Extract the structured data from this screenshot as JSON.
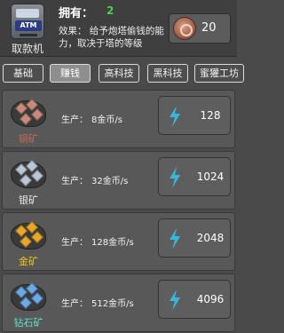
{
  "header": {
    "atm_logo_text": "ATM",
    "atm_name": "取款机",
    "owned_label": "拥有：",
    "owned_value": "2",
    "effect_text": "效果：  给予炮塔偷钱的能力，取决于塔的等级",
    "cost_value": "20",
    "cost_icon": "copper-coin-icon"
  },
  "tabs": [
    {
      "label": "基础",
      "active": false
    },
    {
      "label": "赚钱",
      "active": true
    },
    {
      "label": "高科技",
      "active": false
    },
    {
      "label": "黑科技",
      "active": false
    },
    {
      "label": "蜜獾工坊",
      "active": false
    }
  ],
  "items": [
    {
      "name": "铜矿",
      "name_color": "#c66a55",
      "prod_label": "生产：",
      "prod_value": "8金币/s",
      "price": "128",
      "gem_color": "#c88a7a",
      "icon": "copper-ore-icon"
    },
    {
      "name": "银矿",
      "name_color": "#e8e8e8",
      "prod_label": "生产：",
      "prod_value": "32金币/s",
      "price": "1024",
      "gem_color": "#b9c7d6",
      "icon": "silver-ore-icon"
    },
    {
      "name": "金矿",
      "name_color": "#f0c419",
      "prod_label": "生产：",
      "prod_value": "128金币/s",
      "price": "2048",
      "gem_color": "#e7a82a",
      "icon": "gold-ore-icon"
    },
    {
      "name": "钻石矿",
      "name_color": "#5fe0d0",
      "prod_label": "生产：",
      "prod_value": "512金币/s",
      "price": "4096",
      "gem_color": "#6aa8e6",
      "icon": "diamond-ore-icon"
    }
  ],
  "colors": {
    "owned_value": "#4ccf4c",
    "bolt": "#37b6e0"
  }
}
